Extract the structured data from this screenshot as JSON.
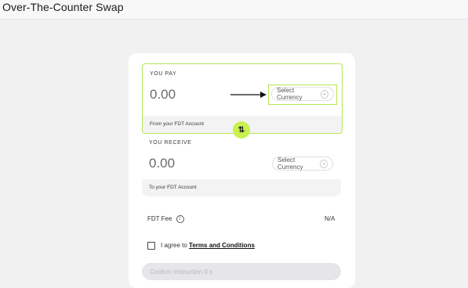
{
  "page": {
    "title": "Over-The-Counter Swap"
  },
  "pay": {
    "label": "YOU PAY",
    "amount": "0.00",
    "currency_select": "Select Currency",
    "account_note": "From your FDT Account"
  },
  "receive": {
    "label": "YOU RECEIVE",
    "amount": "0.00",
    "currency_select": "Select Currency",
    "account_note": "To your FDT Account"
  },
  "swap": {
    "icon": "swap-vertical-icon",
    "glyph": "⇅"
  },
  "fee": {
    "label": "FDT Fee",
    "info_glyph": "i",
    "value": "N/A"
  },
  "terms": {
    "prefix": "I agree to",
    "link": "Terms and Conditions"
  },
  "confirm": {
    "label": "Confirm Instruction  0 s"
  },
  "colors": {
    "accent": "#c8f04f",
    "highlight": "#b5e655",
    "background": "#f1f1f2"
  }
}
